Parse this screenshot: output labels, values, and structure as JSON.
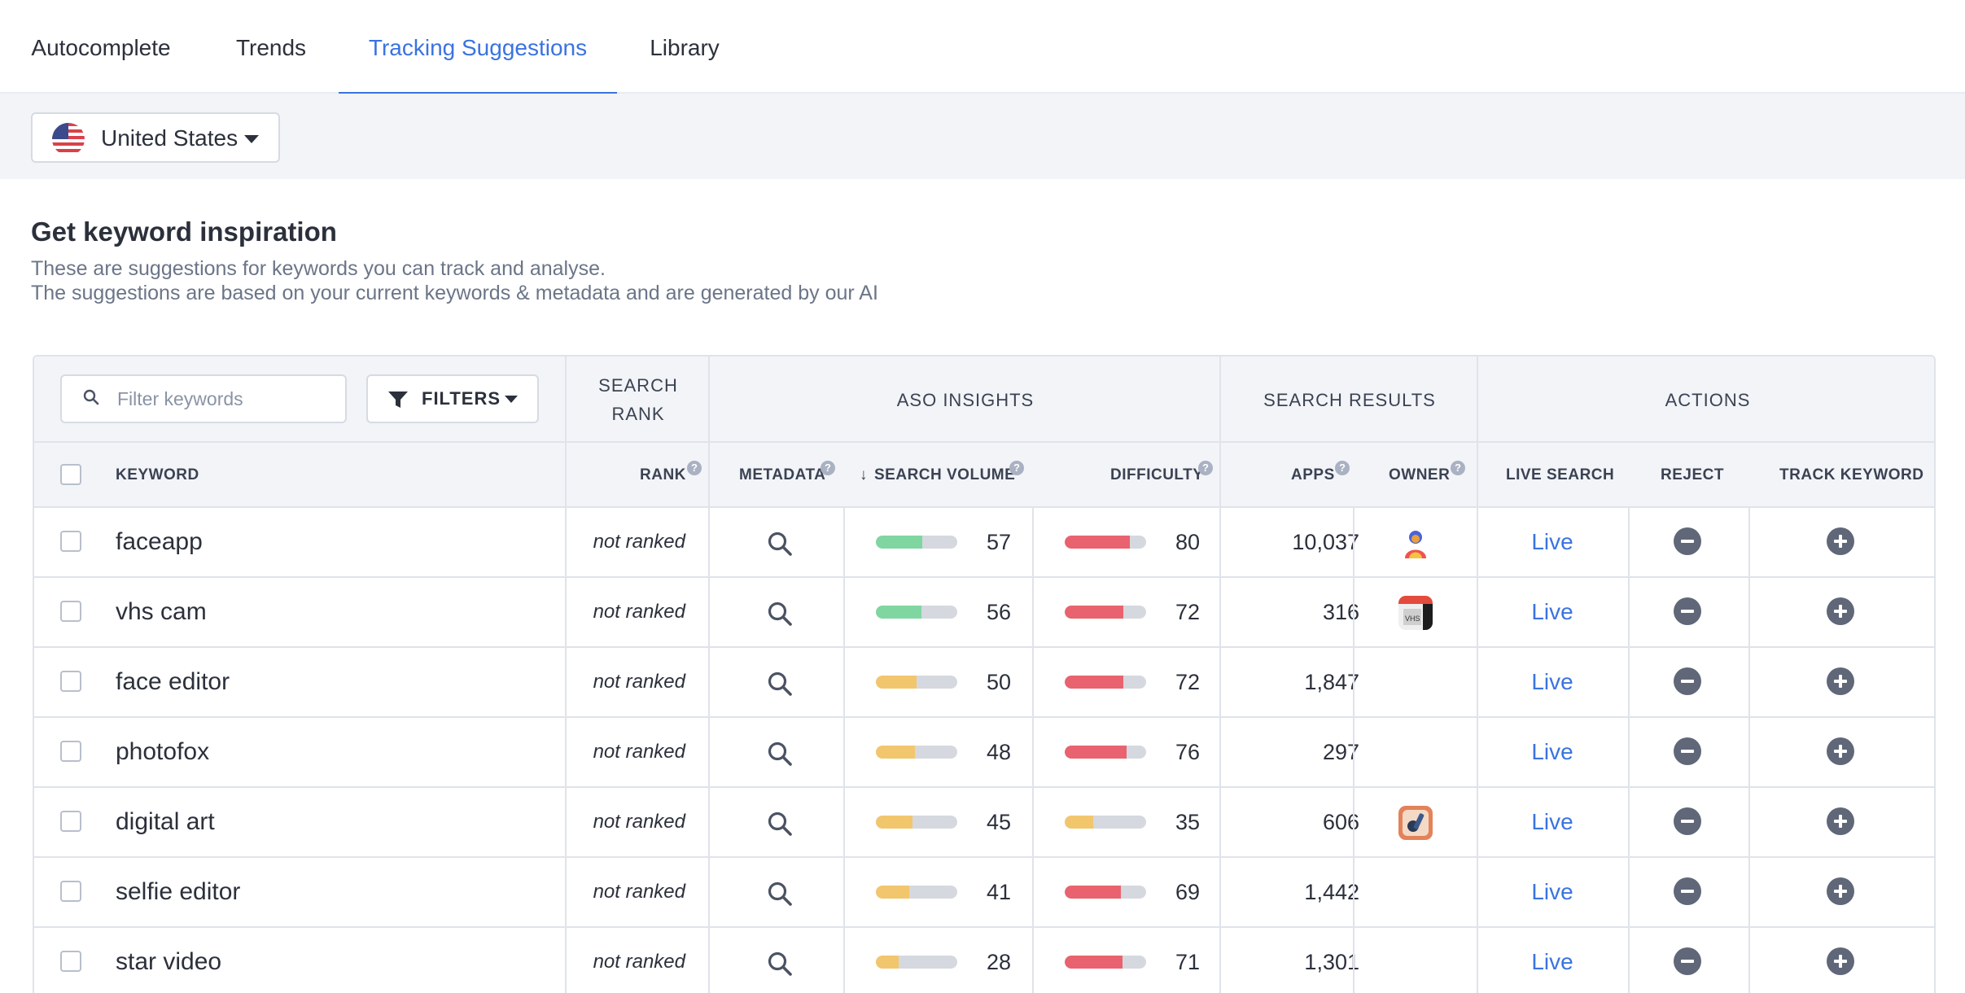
{
  "tabs": [
    {
      "label": "Autocomplete",
      "active": false
    },
    {
      "label": "Trends",
      "active": false
    },
    {
      "label": "Tracking Suggestions",
      "active": true
    },
    {
      "label": "Library",
      "active": false
    }
  ],
  "country": {
    "label": "United States",
    "flag": "us-flag-icon"
  },
  "page": {
    "heading": "Get keyword inspiration",
    "desc1": "These are suggestions for keywords you can track and analyse.",
    "desc2": "The suggestions are based on your current keywords & metadata and are generated by our AI"
  },
  "table": {
    "filter_placeholder": "Filter keywords",
    "filters_label": "FILTERS",
    "groups": {
      "search_rank": "SEARCH RANK",
      "aso_insights": "ASO INSIGHTS",
      "search_results": "SEARCH RESULTS",
      "actions": "ACTIONS"
    },
    "columns": {
      "keyword": "KEYWORD",
      "rank": "RANK",
      "metadata": "METADATA",
      "search_volume": "SEARCH VOLUME",
      "difficulty": "DIFFICULTY",
      "apps": "APPS",
      "owner": "OWNER",
      "live_search": "LIVE SEARCH",
      "reject": "REJECT",
      "track_keyword": "TRACK KEYWORD"
    },
    "help_glyph": "?",
    "sort_glyph": "↓",
    "colors": {
      "volume_high": "#7fd6a0",
      "volume_mid": "#f2c66d",
      "difficulty_high": "#e8636f",
      "difficulty_mid": "#f2c66d",
      "link": "#3a73e0"
    },
    "rows": [
      {
        "keyword": "faceapp",
        "rank": "not ranked",
        "volume": "57",
        "difficulty": "80",
        "apps": "10,037",
        "owner": "faceapp-logo-icon",
        "live": "Live"
      },
      {
        "keyword": "vhs cam",
        "rank": "not ranked",
        "volume": "56",
        "difficulty": "72",
        "apps": "316",
        "owner": "vhs-cam-logo-icon",
        "live": "Live"
      },
      {
        "keyword": "face editor",
        "rank": "not ranked",
        "volume": "50",
        "difficulty": "72",
        "apps": "1,847",
        "owner": "",
        "live": "Live"
      },
      {
        "keyword": "photofox",
        "rank": "not ranked",
        "volume": "48",
        "difficulty": "76",
        "apps": "297",
        "owner": "",
        "live": "Live"
      },
      {
        "keyword": "digital art",
        "rank": "not ranked",
        "volume": "45",
        "difficulty": "35",
        "apps": "606",
        "owner": "art-app-logo-icon",
        "live": "Live"
      },
      {
        "keyword": "selfie editor",
        "rank": "not ranked",
        "volume": "41",
        "difficulty": "69",
        "apps": "1,442",
        "owner": "",
        "live": "Live"
      },
      {
        "keyword": "star video",
        "rank": "not ranked",
        "volume": "28",
        "difficulty": "71",
        "apps": "1,301",
        "owner": "",
        "live": "Live"
      }
    ]
  }
}
